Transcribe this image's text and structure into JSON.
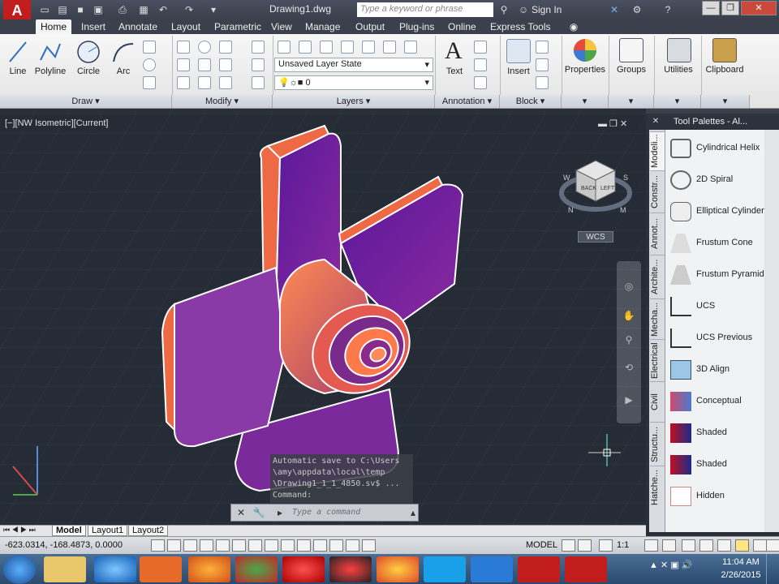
{
  "app": {
    "logo_letter": "A",
    "doc_title": "Drawing1.dwg",
    "search_placeholder": "Type a keyword or phrase",
    "signin": "Sign In"
  },
  "tabs": [
    "Home",
    "Insert",
    "Annotate",
    "Layout",
    "Parametric",
    "View",
    "Manage",
    "Output",
    "Plug-ins",
    "Online",
    "Express Tools"
  ],
  "ribbon": {
    "draw": {
      "line": "Line",
      "polyline": "Polyline",
      "circle": "Circle",
      "arc": "Arc"
    },
    "layer_state": "Unsaved Layer State",
    "layer_current": "0",
    "annotation": {
      "text": "Text"
    },
    "block": {
      "insert": "Insert"
    },
    "big": {
      "properties": "Properties",
      "groups": "Groups",
      "utilities": "Utilities",
      "clipboard": "Clipboard"
    },
    "panels": {
      "draw": "Draw",
      "modify": "Modify",
      "layers": "Layers",
      "annotation": "Annotation",
      "block": "Block"
    }
  },
  "viewport": {
    "label": "[−][NW Isometric][Current]",
    "wcs": "WCS",
    "viewcube": {
      "top": "BACK",
      "side": "LEFT",
      "w": "W",
      "s": "S",
      "n": "N",
      "m": "M"
    }
  },
  "command": {
    "history": "Automatic save to C:\\Users\n\\amy\\appdata\\local\\temp\n\\Drawing1_1_1_4850.sv$ ...\nCommand:",
    "placeholder": "Type a command"
  },
  "layout_tabs": [
    "Model",
    "Layout1",
    "Layout2"
  ],
  "palette": {
    "title": "Tool Palettes - Al...",
    "vtabs": [
      "Modeli...",
      "Constr...",
      "Annot...",
      "Archite...",
      "Mecha...",
      "Electrical",
      "Civil",
      "Structu...",
      "Hatche..."
    ],
    "items": [
      "Cylindrical Helix",
      "2D Spiral",
      "Elliptical Cylinder",
      "Frustum Cone",
      "Frustum Pyramid",
      "UCS",
      "UCS Previous",
      "3D Align",
      "Conceptual",
      "Shaded",
      "Shaded",
      "Hidden"
    ]
  },
  "status": {
    "coords": "-623.0314, -168.4873, 0.0000",
    "model": "MODEL",
    "scale": "1:1"
  },
  "clock": {
    "time": "11:04 AM",
    "date": "2/26/2015"
  },
  "colors": {
    "viewport_bg": "#262c36",
    "fan_purple": "#6a1c9a",
    "fan_orange": "#ee6a45",
    "autocad_red": "#c21d1d"
  }
}
